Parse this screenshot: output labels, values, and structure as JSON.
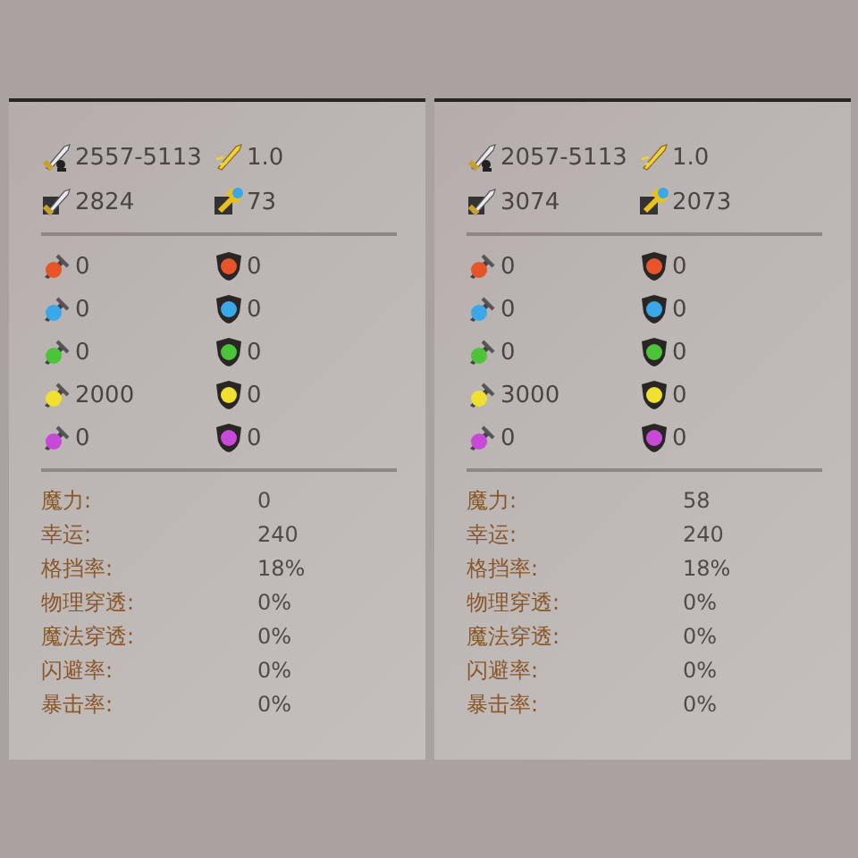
{
  "panels": [
    {
      "top_stats": [
        {
          "kind": "damage",
          "value": "2557-5113"
        },
        {
          "kind": "speed",
          "value": "1.0"
        },
        {
          "kind": "pierce",
          "value": "2824"
        },
        {
          "kind": "hammer",
          "value": "73"
        }
      ],
      "elements": [
        {
          "color": "#e8542a",
          "attack": "0",
          "defense": "0"
        },
        {
          "color": "#3aa8e8",
          "attack": "0",
          "defense": "0"
        },
        {
          "color": "#4cc43a",
          "attack": "0",
          "defense": "0"
        },
        {
          "color": "#f0e030",
          "attack": "2000",
          "defense": "0"
        },
        {
          "color": "#c848d8",
          "attack": "0",
          "defense": "0"
        }
      ],
      "attributes": [
        {
          "label": "魔力:",
          "value": "0"
        },
        {
          "label": "幸运:",
          "value": "240"
        },
        {
          "label": "格挡率:",
          "value": "18%"
        },
        {
          "label": "物理穿透:",
          "value": "0%"
        },
        {
          "label": "魔法穿透:",
          "value": "0%"
        },
        {
          "label": "闪避率:",
          "value": "0%"
        },
        {
          "label": "暴击率:",
          "value": "0%"
        }
      ]
    },
    {
      "top_stats": [
        {
          "kind": "damage",
          "value": "2057-5113"
        },
        {
          "kind": "speed",
          "value": "1.0"
        },
        {
          "kind": "pierce",
          "value": "3074"
        },
        {
          "kind": "hammer",
          "value": "2073"
        }
      ],
      "elements": [
        {
          "color": "#e8542a",
          "attack": "0",
          "defense": "0"
        },
        {
          "color": "#3aa8e8",
          "attack": "0",
          "defense": "0"
        },
        {
          "color": "#4cc43a",
          "attack": "0",
          "defense": "0"
        },
        {
          "color": "#f0e030",
          "attack": "3000",
          "defense": "0"
        },
        {
          "color": "#c848d8",
          "attack": "0",
          "defense": "0"
        }
      ],
      "attributes": [
        {
          "label": "魔力:",
          "value": "58"
        },
        {
          "label": "幸运:",
          "value": "240"
        },
        {
          "label": "格挡率:",
          "value": "18%"
        },
        {
          "label": "物理穿透:",
          "value": "0%"
        },
        {
          "label": "魔法穿透:",
          "value": "0%"
        },
        {
          "label": "闪避率:",
          "value": "0%"
        },
        {
          "label": "暴击率:",
          "value": "0%"
        }
      ]
    }
  ]
}
